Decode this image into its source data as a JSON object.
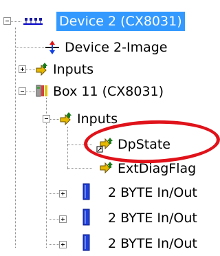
{
  "tree": {
    "items": [
      {
        "label": "Device 2 (CX8031)",
        "icon": "profibus-device-icon",
        "expanded": true,
        "selected": true
      },
      {
        "label": "Device 2-Image",
        "icon": "process-image-icon"
      },
      {
        "label": "Inputs",
        "icon": "inputs-icon",
        "expanded": false
      },
      {
        "label": "Box 11 (CX8031)",
        "icon": "box-device-icon",
        "expanded": true
      },
      {
        "label": "Inputs",
        "icon": "inputs-icon",
        "expanded": true
      },
      {
        "label": "DpState",
        "icon": "input-variable-linked-icon"
      },
      {
        "label": "ExtDiagFlag",
        "icon": "input-variable-icon"
      },
      {
        "label": "2 BYTE In/Out",
        "icon": "module-icon",
        "expanded": false
      },
      {
        "label": "2 BYTE In/Out",
        "icon": "module-icon",
        "expanded": false
      },
      {
        "label": "2 BYTE In/Out",
        "icon": "module-icon",
        "expanded": false
      }
    ]
  },
  "colors": {
    "selection": "#3399ff",
    "callout": "#e0121a"
  }
}
